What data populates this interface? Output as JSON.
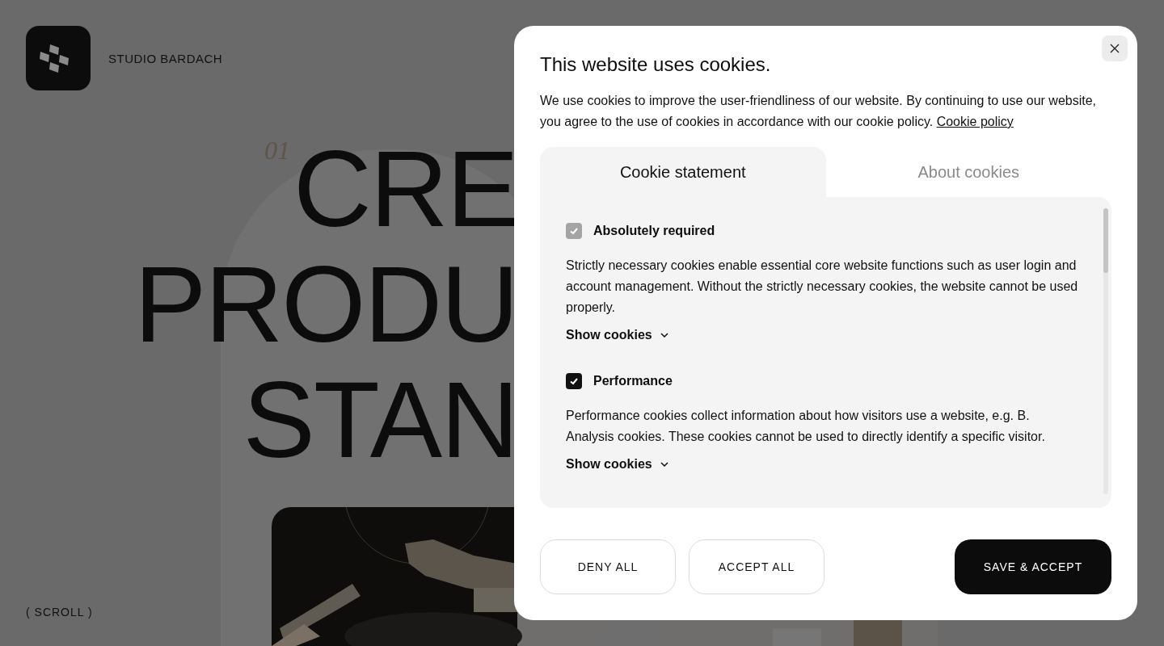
{
  "header": {
    "brand": "STUDIO BARDACH"
  },
  "hero": {
    "number": "01",
    "lines": [
      "CRE",
      "PRODU",
      "STAN"
    ]
  },
  "scroll_hint": "( SCROLL )",
  "dialog": {
    "title": "This website uses cookies.",
    "text": "We use cookies to improve the user-friendliness of our website. By continuing to use our website, you agree to the use of cookies in accordance with our cookie policy.",
    "link": "Cookie policy",
    "tabs": [
      {
        "label": "Cookie statement",
        "selected": true
      },
      {
        "label": "About cookies",
        "selected": false
      }
    ],
    "categories": [
      {
        "title": "Absolutely required",
        "checked": true,
        "disabled": true,
        "description": "Strictly necessary cookies enable essential core website functions such as user login and account management. Without the strictly necessary cookies, the website cannot be used properly.",
        "toggle": "Show cookies"
      },
      {
        "title": "Performance",
        "checked": true,
        "disabled": false,
        "description": "Performance cookies collect information about how visitors use a website, e.g. B. Analysis cookies. These cookies cannot be used to directly identify a specific visitor.",
        "toggle": "Show cookies"
      }
    ],
    "buttons": [
      {
        "label": "DENY ALL",
        "kind": "secondary"
      },
      {
        "label": "ACCEPT ALL",
        "kind": "secondary"
      },
      {
        "label": "SAVE & ACCEPT",
        "kind": "primary"
      }
    ]
  }
}
